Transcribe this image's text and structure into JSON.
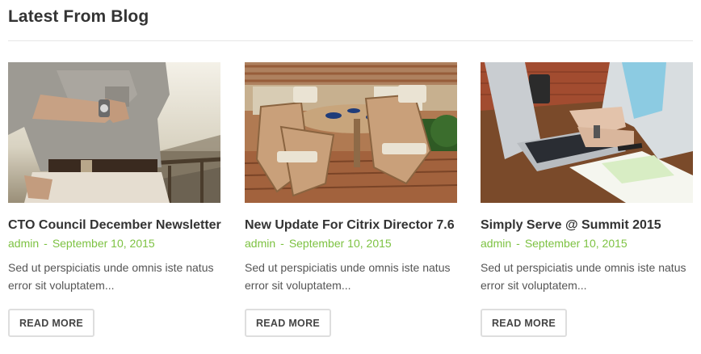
{
  "section": {
    "title": "Latest From Blog"
  },
  "posts": [
    {
      "title": "CTO Council December Newsletter",
      "author": "admin",
      "separator": "-",
      "date": "September 10, 2015",
      "excerpt": "Sed ut perspiciatis unde omnis iste natus error sit voluptatem...",
      "button": "READ MORE",
      "image": "man-checking-watch-photo"
    },
    {
      "title": "New Update For Citrix Director 7.6",
      "author": "admin",
      "separator": "-",
      "date": "September 10, 2015",
      "excerpt": "Sed ut perspiciatis unde omnis iste natus error sit voluptatem...",
      "button": "READ MORE",
      "image": "patio-furniture-photo"
    },
    {
      "title": "Simply Serve @ Summit 2015",
      "author": "admin",
      "separator": "-",
      "date": "September 10, 2015",
      "excerpt": "Sed ut perspiciatis unde omnis iste natus error sit voluptatem...",
      "button": "READ MORE",
      "image": "woman-typing-laptop-photo"
    }
  ],
  "colors": {
    "accent": "#7dc242",
    "title": "#333333",
    "text": "#555555",
    "border": "#dedede"
  }
}
